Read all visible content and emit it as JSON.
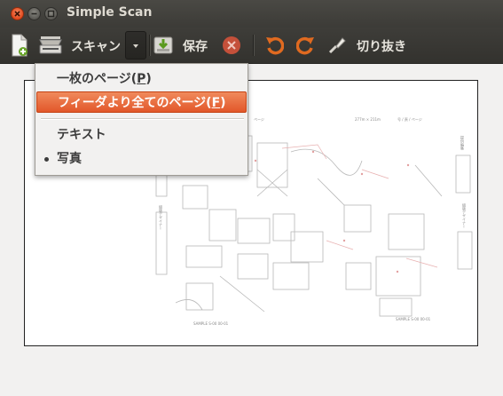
{
  "window": {
    "title": "Simple Scan"
  },
  "toolbar": {
    "scan_label": "スキャン",
    "save_label": "保存",
    "crop_label": "切り抜き"
  },
  "scan_menu": {
    "items": [
      {
        "label": "一枚のページ(",
        "accel": "P",
        "suffix": ")"
      },
      {
        "label": "フィーダより全てのページ(",
        "accel": "F",
        "suffix": ")"
      }
    ],
    "mode_items": [
      {
        "label": "テキスト",
        "checked": false
      },
      {
        "label": "写真",
        "checked": true
      }
    ]
  },
  "document_texts": {
    "page_header": "ページ",
    "size": "277m × 211m",
    "page_no": "号 / 頁 / ページ",
    "side_label_1": "提供編集",
    "side_label_2": "組版デザイナー",
    "left_label": "組版デザイナー",
    "footer_1": "SAMPLE S-00 00-01",
    "footer_2": "SAMPLE S-00 00-01"
  }
}
